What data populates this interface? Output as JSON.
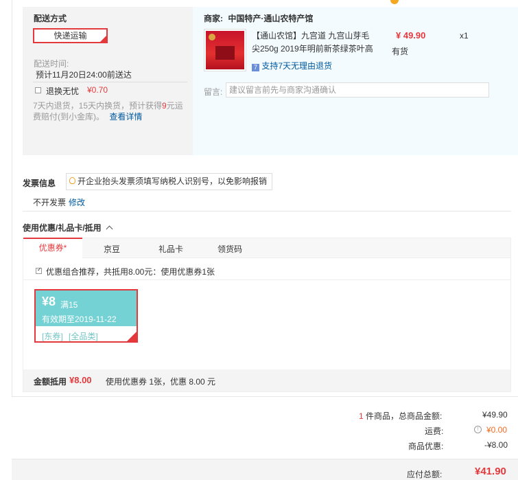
{
  "shipping": {
    "title": "配送方式",
    "method": "快递运输",
    "time_label": "配送时间:",
    "time_value": "预计11月20日24:00前送达",
    "worry_free_label": "退换无忧",
    "worry_free_price": "¥0.70",
    "worry_free_desc_1": "7天内退货，15天内换货，预计获得",
    "worry_free_desc_highlight": "9",
    "worry_free_desc_2": "元运",
    "worry_free_desc_3": "费赔付(到小金库)。",
    "details_link": "查看详情"
  },
  "shop": {
    "merchant_label": "商家:",
    "merchant_name": "中国特产·通山农特产馆",
    "product_title_line1": "【通山农馆】九宫道 九宫山芽毛",
    "product_title_line2": "尖250g 2019年明前新茶绿茶叶高",
    "price": "¥ 49.90",
    "quantity": "x1",
    "stock": "有货",
    "return_policy": "支持7天无理由退货",
    "memo_label": "留言:",
    "memo_placeholder": "建议留言前先与商家沟通确认"
  },
  "invoice": {
    "title": "发票信息",
    "tip": "开企业抬头发票须填写纳税人识别号，以免影响报销",
    "status": "不开发票",
    "modify_link": "修改"
  },
  "discount": {
    "title": "使用优惠/礼品卡/抵用",
    "tabs": [
      "优惠券*",
      "京豆",
      "礼品卡",
      "领货码"
    ],
    "recommend_text": "优惠组合推荐，共抵用8.00元：使用优惠券1张",
    "coupon": {
      "amount": "¥8",
      "condition": "满15",
      "validity": "有效期至2019-11-22",
      "tag1": "[东券]",
      "tag2": "[全品类]"
    },
    "deduct_label": "金额抵用",
    "deduct_amount": "¥8.00",
    "deduct_desc": "使用优惠券 1张，优惠 8.00 元"
  },
  "summary": {
    "count": "1",
    "count_text": "件商品，总商品金额:",
    "goods_total": "¥49.90",
    "freight_label": "运费:",
    "freight_value": "¥0.00",
    "discount_label": "商品优惠:",
    "discount_value": "-¥8.00",
    "payable_label": "应付总额:",
    "payable_value": "¥41.90"
  },
  "colors": {
    "accent": "#e4393c",
    "link": "#005aa0",
    "coupon": "#74d2d4"
  }
}
